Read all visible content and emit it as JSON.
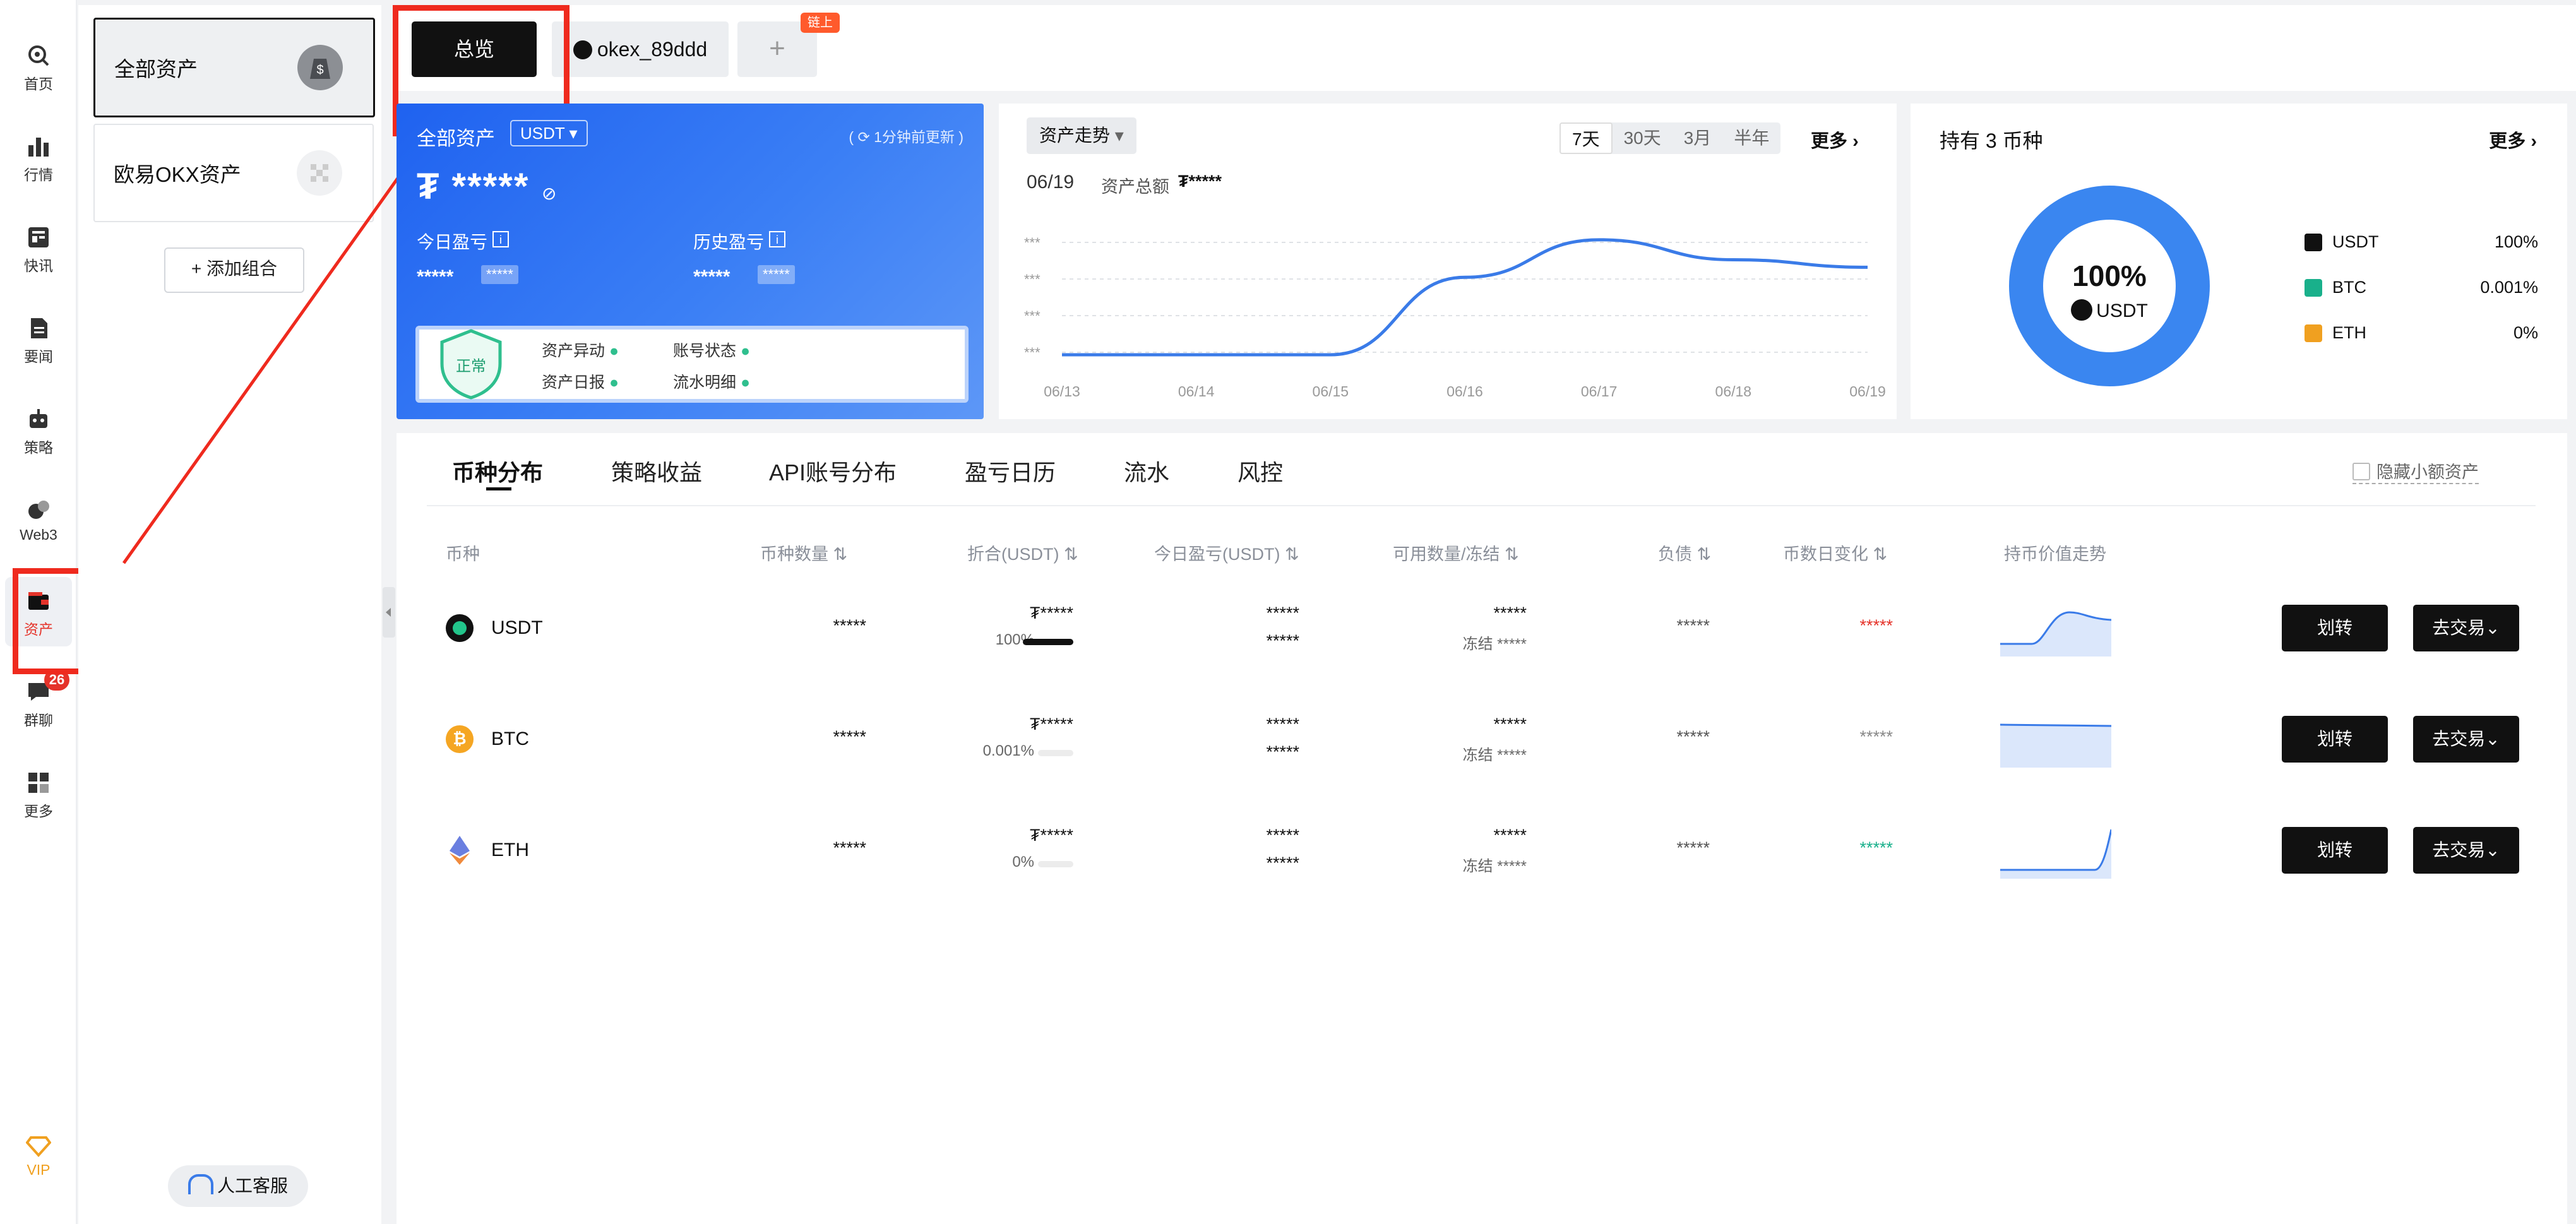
{
  "nav": [
    {
      "label": "首页",
      "icon": "home-icon"
    },
    {
      "label": "行情",
      "icon": "chart-bars-icon"
    },
    {
      "label": "快讯",
      "icon": "news-flash-icon"
    },
    {
      "label": "要闻",
      "icon": "document-icon"
    },
    {
      "label": "策略",
      "icon": "robot-icon"
    },
    {
      "label": "Web3",
      "icon": "web3-icon"
    },
    {
      "label": "资产",
      "icon": "wallet-icon"
    },
    {
      "label": "群聊",
      "icon": "chat-icon",
      "badge": "26"
    },
    {
      "label": "更多",
      "icon": "grid-icon"
    },
    {
      "label": "VIP",
      "icon": "diamond-icon"
    }
  ],
  "portfolio": {
    "items": [
      {
        "label": "全部资产"
      },
      {
        "label": "欧易OKX资产"
      }
    ],
    "add_label": "+ 添加组合",
    "support_label": "人工客服"
  },
  "top_tabs": {
    "overview": "总览",
    "account": "okex_89ddd",
    "add_symbol": "+",
    "chain_badge": "链上"
  },
  "asset_card": {
    "title": "全部资产",
    "currency": "USDT",
    "updated": "1分钟前更新",
    "total": "₮ *****",
    "today_label": "今日盈亏",
    "history_label": "历史盈亏",
    "today_value": "*****",
    "today_pct": "*****",
    "history_value": "*****",
    "history_pct": "*****",
    "status": "正常",
    "checks": [
      "资产异动",
      "账号状态",
      "资产日报",
      "流水明细"
    ]
  },
  "trend": {
    "dropdown": "资产走势",
    "ranges": [
      "7天",
      "30天",
      "3月",
      "半年"
    ],
    "active_range": "7天",
    "more": "更多",
    "date": "06/19",
    "total_label": "资产总额",
    "total_value": "₮*****",
    "ytick_label": "***"
  },
  "chart_data": {
    "type": "line",
    "title": "",
    "xlabel": "",
    "ylabel": "",
    "categories": [
      "06/13",
      "06/14",
      "06/15",
      "06/16",
      "06/17",
      "06/18",
      "06/19"
    ],
    "series": [
      {
        "name": "",
        "values": [
          0.0,
          0.0,
          0.0,
          0.62,
          0.92,
          0.76,
          0.7
        ]
      }
    ],
    "ylim": [
      0,
      1
    ],
    "grid": true,
    "colors": {
      "line": "#3a7be8"
    }
  },
  "holding": {
    "title": "持有 3 币种",
    "more": "更多",
    "center_pct": "100%",
    "center_coin": "USDT",
    "legend": [
      {
        "name": "USDT",
        "pct": "100%",
        "color": "#111111"
      },
      {
        "name": "BTC",
        "pct": "0.001%",
        "color": "#19b08b"
      },
      {
        "name": "ETH",
        "pct": "0%",
        "color": "#f0a020"
      }
    ],
    "ring_color": "#3a86f0"
  },
  "table": {
    "tabs": [
      "币种分布",
      "策略收益",
      "API账号分布",
      "盈亏日历",
      "流水",
      "风控"
    ],
    "hide_small": "隐藏小额资产",
    "headers": [
      "币种",
      "币种数量",
      "折合(USDT)",
      "今日盈亏(USDT)",
      "可用数量/冻结",
      "负债",
      "币数日变化",
      "持币价值走势"
    ],
    "rows": [
      {
        "coin": "USDT",
        "qty": "*****",
        "value": "₮*****",
        "pct": "100%",
        "pct_num": 100,
        "pnl1": "*****",
        "pnl2": "*****",
        "avail": "*****",
        "frozen": "冻结 *****",
        "debt": "*****",
        "change": "*****",
        "change_color": "#e5332a",
        "transfer": "划转",
        "trade": "去交易"
      },
      {
        "coin": "BTC",
        "qty": "*****",
        "value": "₮*****",
        "pct": "0.001%",
        "pct_num": 0.001,
        "pnl1": "*****",
        "pnl2": "*****",
        "avail": "*****",
        "frozen": "冻结 *****",
        "debt": "*****",
        "change": "*****",
        "change_color": "#888888",
        "transfer": "划转",
        "trade": "去交易"
      },
      {
        "coin": "ETH",
        "qty": "*****",
        "value": "₮*****",
        "pct": "0%",
        "pct_num": 0,
        "pnl1": "*****",
        "pnl2": "*****",
        "avail": "*****",
        "frozen": "冻结 *****",
        "debt": "*****",
        "change": "*****",
        "change_color": "#19b08b",
        "transfer": "划转",
        "trade": "去交易"
      }
    ]
  }
}
